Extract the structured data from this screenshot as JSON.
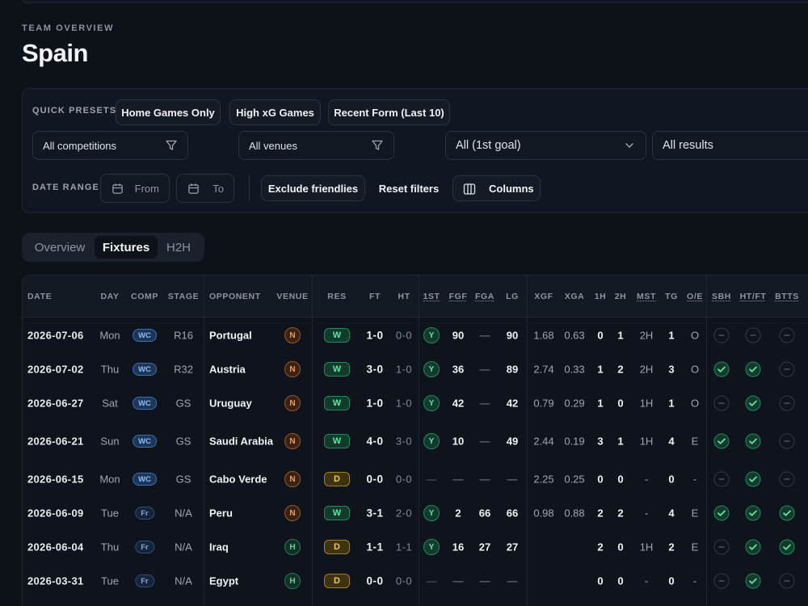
{
  "header": {
    "section_label": "TEAM OVERVIEW",
    "title": "Spain"
  },
  "filters": {
    "quick_presets_label": "QUICK PRESETS",
    "presets": [
      "Home Games Only",
      "High xG Games",
      "Recent Form (Last 10)"
    ],
    "competitions": "All competitions",
    "venues": "All venues",
    "first_goal": "All (1st goal)",
    "results": "All results",
    "date_range_label": "DATE RANGE",
    "from_placeholder": "From",
    "to_placeholder": "To",
    "exclude_friendlies": "Exclude friendlies",
    "reset_filters": "Reset filters",
    "columns": "Columns"
  },
  "tabs": [
    "Overview",
    "Fixtures",
    "H2H"
  ],
  "active_tab": "Fixtures",
  "table": {
    "columns": [
      "DATE",
      "DAY",
      "COMP",
      "STAGE",
      "OPPONENT",
      "VENUE",
      "RES",
      "FT",
      "HT",
      "1ST",
      "FGF",
      "FGA",
      "LG",
      "XGF",
      "XGA",
      "1H",
      "2H",
      "MST",
      "TG",
      "O/E",
      "SBH",
      "HT/FT",
      "BTTS"
    ],
    "rows": [
      {
        "date": "2026-07-06",
        "day": "Mon",
        "comp": "WC",
        "stage": "R16",
        "opponent": "Portugal",
        "venue": "N",
        "res": "W",
        "ft": "1-0",
        "ht": "0-0",
        "first": "Y",
        "fgf": "90",
        "fga": "—",
        "lg": "90",
        "xgf": "1.68",
        "xga": "0.63",
        "h1": "0",
        "h2": "1",
        "mst": "2H",
        "tg": "1",
        "oe": "O",
        "sbh": "no",
        "htft": "no",
        "btts": "no"
      },
      {
        "date": "2026-07-02",
        "day": "Thu",
        "comp": "WC",
        "stage": "R32",
        "opponent": "Austria",
        "venue": "N",
        "res": "W",
        "ft": "3-0",
        "ht": "1-0",
        "first": "Y",
        "fgf": "36",
        "fga": "—",
        "lg": "89",
        "xgf": "2.74",
        "xga": "0.33",
        "h1": "1",
        "h2": "2",
        "mst": "2H",
        "tg": "3",
        "oe": "O",
        "sbh": "yes",
        "htft": "yes",
        "btts": "no"
      },
      {
        "date": "2026-06-27",
        "day": "Sat",
        "comp": "WC",
        "stage": "GS",
        "opponent": "Uruguay",
        "venue": "N",
        "res": "W",
        "ft": "1-0",
        "ht": "1-0",
        "first": "Y",
        "fgf": "42",
        "fga": "—",
        "lg": "42",
        "xgf": "0.79",
        "xga": "0.29",
        "h1": "1",
        "h2": "0",
        "mst": "1H",
        "tg": "1",
        "oe": "O",
        "sbh": "no",
        "htft": "yes",
        "btts": "no"
      },
      {
        "date": "2026-06-21",
        "day": "Sun",
        "comp": "WC",
        "stage": "GS",
        "opponent": "Saudi Arabia",
        "venue": "N",
        "res": "W",
        "ft": "4-0",
        "ht": "3-0",
        "first": "Y",
        "fgf": "10",
        "fga": "—",
        "lg": "49",
        "xgf": "2.44",
        "xga": "0.19",
        "h1": "3",
        "h2": "1",
        "mst": "1H",
        "tg": "4",
        "oe": "E",
        "sbh": "yes",
        "htft": "yes",
        "btts": "no"
      },
      {
        "date": "2026-06-15",
        "day": "Mon",
        "comp": "WC",
        "stage": "GS",
        "opponent": "Cabo Verde",
        "venue": "N",
        "res": "D",
        "ft": "0-0",
        "ht": "0-0",
        "first": "—",
        "fgf": "—",
        "fga": "—",
        "lg": "—",
        "xgf": "2.25",
        "xga": "0.25",
        "h1": "0",
        "h2": "0",
        "mst": "-",
        "tg": "0",
        "oe": "-",
        "sbh": "no",
        "htft": "yes",
        "btts": "no"
      },
      {
        "date": "2026-06-09",
        "day": "Tue",
        "comp": "Fr",
        "stage": "N/A",
        "opponent": "Peru",
        "venue": "N",
        "res": "W",
        "ft": "3-1",
        "ht": "2-0",
        "first": "Y",
        "fgf": "2",
        "fga": "66",
        "lg": "66",
        "xgf": "0.98",
        "xga": "0.88",
        "h1": "2",
        "h2": "2",
        "mst": "-",
        "tg": "4",
        "oe": "E",
        "sbh": "yes",
        "htft": "yes",
        "btts": "yes"
      },
      {
        "date": "2026-06-04",
        "day": "Thu",
        "comp": "Fr",
        "stage": "N/A",
        "opponent": "Iraq",
        "venue": "H",
        "res": "D",
        "ft": "1-1",
        "ht": "1-1",
        "first": "Y",
        "fgf": "16",
        "fga": "27",
        "lg": "27",
        "xgf": "",
        "xga": "",
        "h1": "2",
        "h2": "0",
        "mst": "1H",
        "tg": "2",
        "oe": "E",
        "sbh": "no",
        "htft": "yes",
        "btts": "yes"
      },
      {
        "date": "2026-03-31",
        "day": "Tue",
        "comp": "Fr",
        "stage": "N/A",
        "opponent": "Egypt",
        "venue": "H",
        "res": "D",
        "ft": "0-0",
        "ht": "0-0",
        "first": "—",
        "fgf": "—",
        "fga": "—",
        "lg": "—",
        "xgf": "",
        "xga": "",
        "h1": "0",
        "h2": "0",
        "mst": "-",
        "tg": "0",
        "oe": "-",
        "sbh": "no",
        "htft": "yes",
        "btts": "no"
      }
    ]
  },
  "colors": {
    "background": "#0d1118",
    "panel": "#111722",
    "win": "#5fe3a6",
    "draw": "#f3c84a",
    "neutral_venue": "#f29a4f",
    "home_venue": "#4fd69c",
    "comp_badge": "#8fbaf5"
  }
}
